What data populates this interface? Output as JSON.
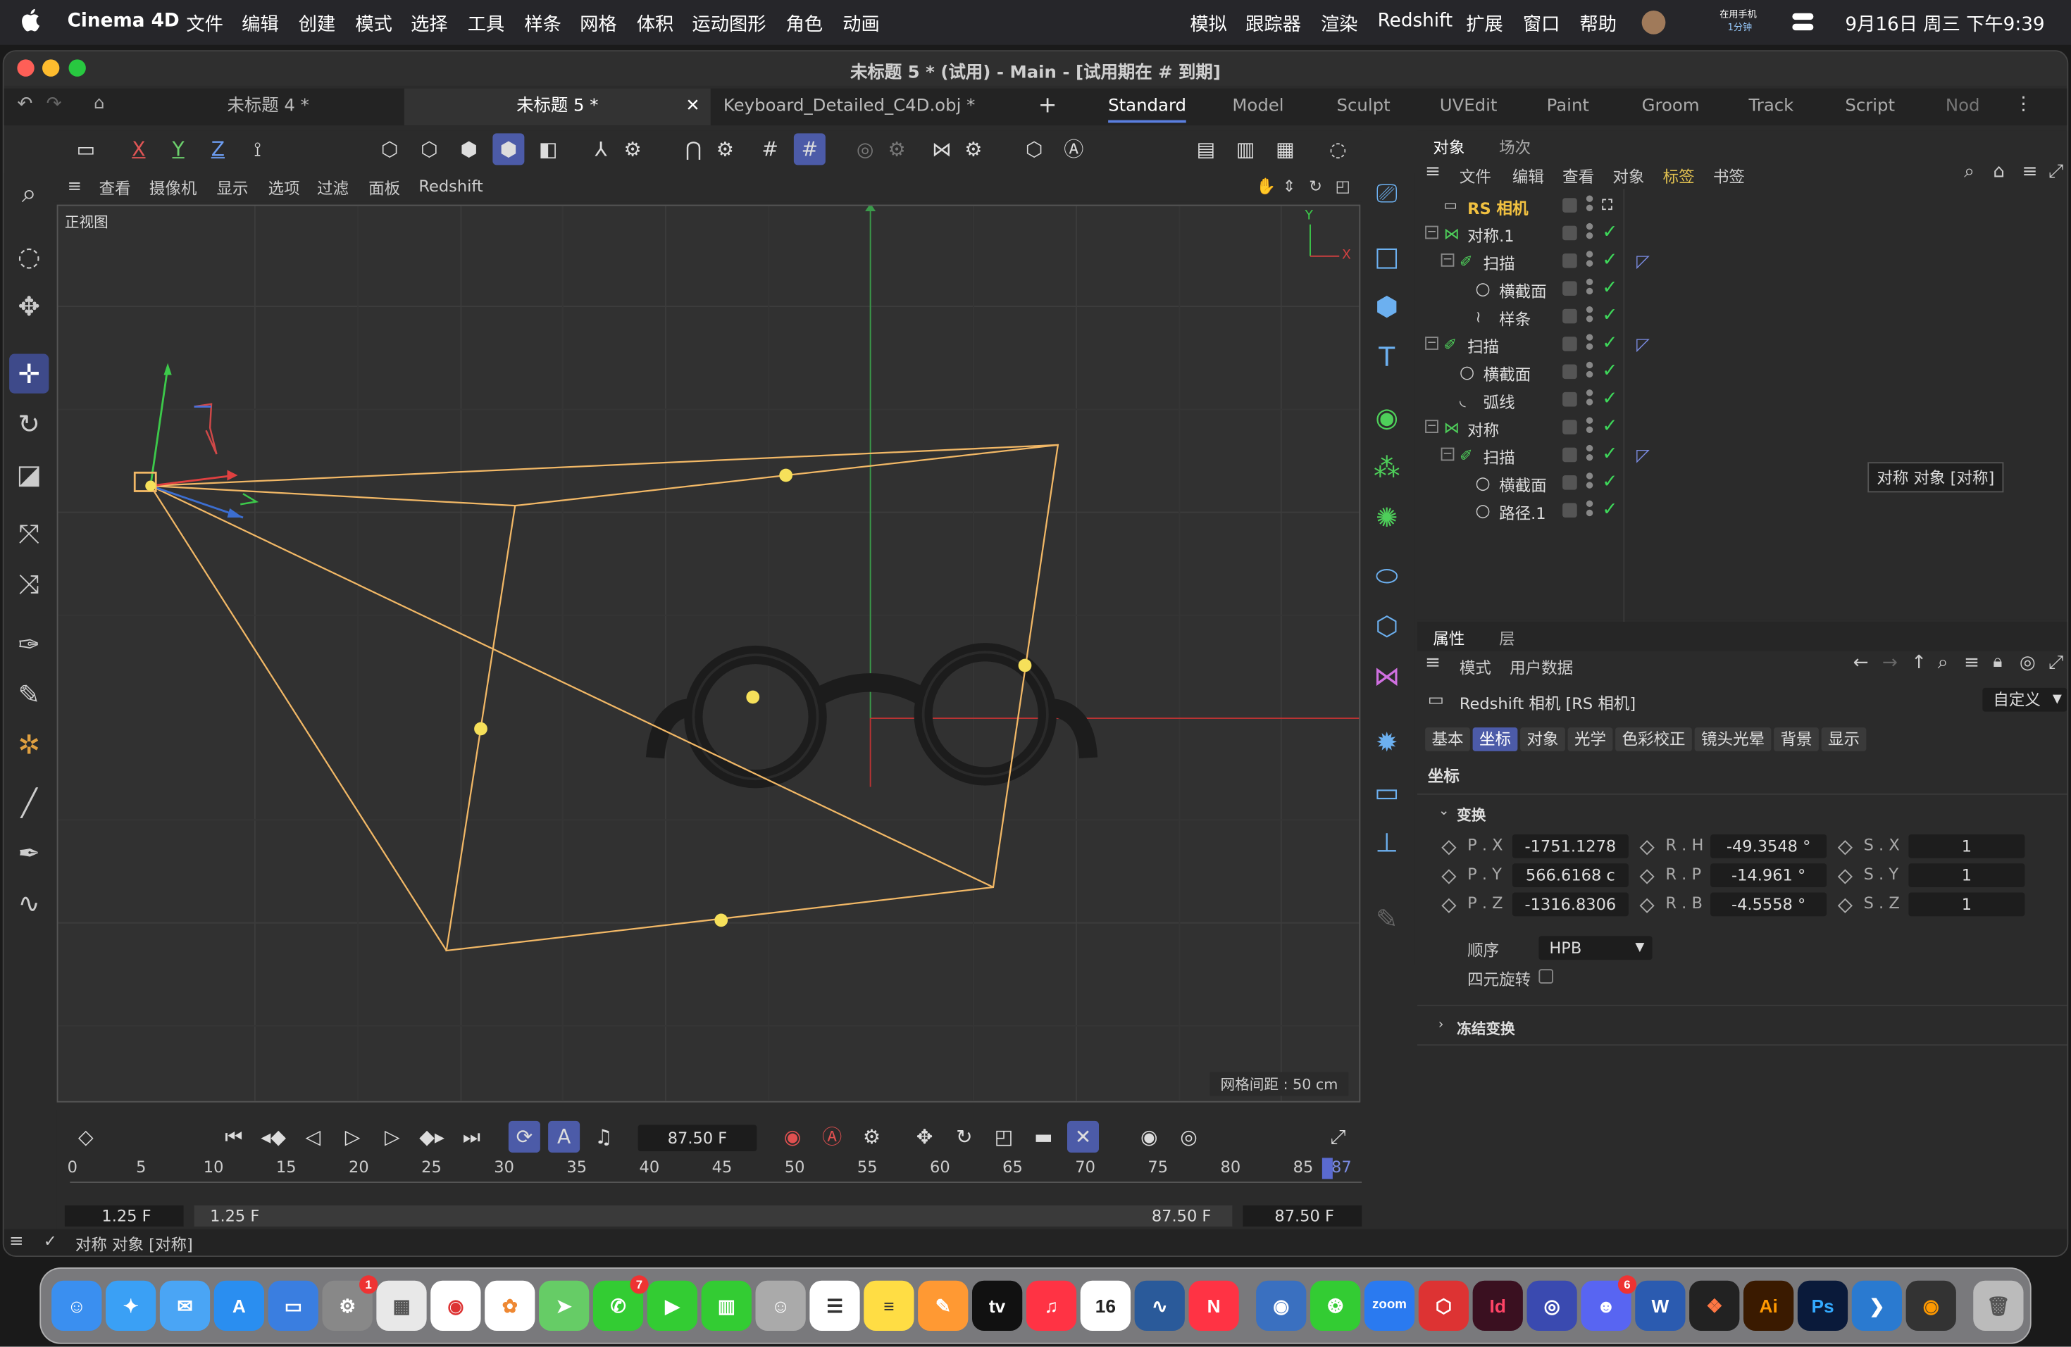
{
  "menubar": {
    "app_name": "Cinema 4D",
    "left_items": [
      "文件",
      "编辑",
      "创建",
      "模式",
      "选择",
      "工具",
      "样条",
      "网格",
      "体积",
      "运动图形",
      "角色",
      "动画"
    ],
    "right_items": [
      "模拟",
      "跟踪器",
      "渲染",
      "Redshift",
      "扩展",
      "窗口",
      "帮助"
    ],
    "phone_label_1": "在用手机",
    "phone_label_2": "1分钟",
    "datetime": "9月16日 周三  下午9:39"
  },
  "window": {
    "title": "未标题 5 * (试用) - Main - [试用期在 # 到期]"
  },
  "tabs": {
    "docs": [
      "未标题 4 *",
      "未标题 5 *",
      "Keyboard_Detailed_C4D.obj *"
    ],
    "active_doc": 1,
    "add": "+",
    "layouts": [
      "Standard",
      "Model",
      "Sculpt",
      "UVEdit",
      "Paint",
      "Groom",
      "Track",
      "Script",
      "Nod"
    ],
    "active_layout": 0
  },
  "toolbar": {
    "axis_x": "X",
    "axis_y": "Y",
    "axis_z": "Z"
  },
  "viewport": {
    "menu": [
      "查看",
      "摄像机",
      "显示",
      "选项",
      "过滤",
      "面板",
      "Redshift"
    ],
    "view_name": "正视图",
    "grid_spacing": "网格间距 : 50 cm",
    "axis_y": "Y",
    "axis_x": "X"
  },
  "timeline": {
    "current_frame": "87.50 F",
    "ticks": [
      "0",
      "5",
      "10",
      "15",
      "20",
      "25",
      "30",
      "35",
      "40",
      "45",
      "50",
      "55",
      "60",
      "65",
      "70",
      "75",
      "80",
      "85",
      "87"
    ],
    "range_start": "1.25 F",
    "range_start2": "1.25 F",
    "range_end": "87.50 F",
    "range_end2": "87.50 F"
  },
  "status": {
    "text": "对称 对象 [对称]"
  },
  "objects_panel": {
    "tabs": [
      "对象",
      "场次"
    ],
    "menu": [
      "文件",
      "编辑",
      "查看",
      "对象",
      "标签",
      "书签"
    ],
    "rows": [
      {
        "label": "RS 相机",
        "icon": "camera-icon"
      },
      {
        "label": "对称.1",
        "icon": "symmetry-icon"
      },
      {
        "label": "扫描",
        "icon": "sweep-icon"
      },
      {
        "label": "横截面",
        "icon": "circle-icon"
      },
      {
        "label": "样条",
        "icon": "spline-icon"
      },
      {
        "label": "扫描",
        "icon": "sweep-icon"
      },
      {
        "label": "横截面",
        "icon": "circle-icon"
      },
      {
        "label": "弧线",
        "icon": "arc-icon"
      },
      {
        "label": "对称",
        "icon": "symmetry-icon"
      },
      {
        "label": "扫描",
        "icon": "sweep-icon"
      },
      {
        "label": "横截面",
        "icon": "circle-icon"
      },
      {
        "label": "路径.1",
        "icon": "circle-icon"
      }
    ],
    "tooltip": "对称 对象 [对称]"
  },
  "attributes_panel": {
    "tabs": [
      "属性",
      "层"
    ],
    "menu": [
      "模式",
      "用户数据"
    ],
    "object_title": "Redshift 相机 [RS 相机]",
    "preset": "自定义",
    "sub_tabs": [
      "基本",
      "坐标",
      "对象",
      "光学",
      "色彩校正",
      "镜头光晕",
      "背景",
      "显示"
    ],
    "active_sub_tab": 1,
    "section": "坐标",
    "group": "变换",
    "fields": {
      "px_label": "P . X",
      "px": "-1751.1278",
      "py_label": "P . Y",
      "py": "566.6168 c",
      "pz_label": "P . Z",
      "pz": "-1316.8306",
      "rh_label": "R . H",
      "rh": "-49.3548 °",
      "rp_label": "R . P",
      "rp": "-14.961 °",
      "rb_label": "R . B",
      "rb": "-4.5558 °",
      "sx_label": "S . X",
      "sx": "1",
      "sy_label": "S . Y",
      "sy": "1",
      "sz_label": "S . Z",
      "sz": "1"
    },
    "order_label": "顺序",
    "order_value": "HPB",
    "quat_label": "四元旋转",
    "freeze_label": "冻结变换"
  },
  "dock": {
    "items": [
      "Finder",
      "Safari",
      "Mail",
      "App Store",
      "Keynote",
      "System Settings",
      "Launchpad",
      "Chrome",
      "Photos",
      "Maps",
      "Messages",
      "FaceTime",
      "Numbers",
      "Contacts",
      "Reminders",
      "Notes",
      "Pages",
      "TV",
      "Music",
      "Calendar",
      "Freeform",
      "News",
      "Container",
      "WeChat",
      "Zoom",
      "Cinema 4D",
      "InDesign",
      "Safari Tech",
      "Discord",
      "Word",
      "Figma",
      "Illustrator",
      "Photoshop",
      "VS Code",
      "Blender",
      "Trash"
    ],
    "tv_label": "tv",
    "calendar_day": "16",
    "zoom_label": "zoom",
    "id_label": "Id",
    "ai_label": "Ai",
    "ps_label": "Ps",
    "w_label": "W",
    "settings_badge": "1",
    "messages_badge": "7",
    "discord_badge": "6"
  },
  "colors": {
    "accent": "#4c5ba8",
    "camera_frustum": "#f2b866",
    "check_green": "#3ed85a",
    "x_axis": "#e04040",
    "y_axis": "#40c060"
  }
}
